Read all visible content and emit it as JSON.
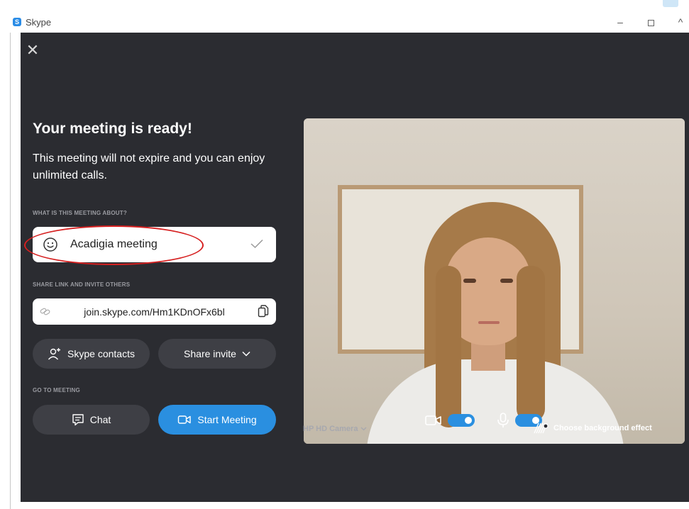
{
  "window": {
    "app_title": "Skype",
    "minimize_symbol": "–",
    "close_symbol": "^"
  },
  "panel": {
    "close_symbol": "✕",
    "heading": "Your meeting is ready!",
    "subtext": "This meeting will not expire and you can enjoy unlimited calls.",
    "about_label": "WHAT IS THIS MEETING ABOUT?",
    "meeting_name": "Acadigia meeting",
    "share_label": "SHARE LINK AND INVITE OTHERS",
    "link": "join.skype.com/Hm1KDnOFx6bl",
    "contacts_button": "Skype contacts",
    "share_invite_button": "Share invite",
    "goto_label": "GO TO MEETING",
    "chat_button": "Chat",
    "start_button": "Start Meeting"
  },
  "preview": {
    "video_enabled": true,
    "mic_enabled": true,
    "camera_name": "HP HD Camera",
    "background_effect_label": "Choose background effect"
  },
  "colors": {
    "panel_bg": "#2b2c31",
    "pill_bg": "#3e3f45",
    "accent": "#2a8fe0",
    "annotation": "#d62020"
  },
  "icons": [
    "skype-icon",
    "close-icon",
    "smiley-icon",
    "check-icon",
    "link-icon",
    "copy-icon",
    "add-contact-icon",
    "chevron-down-icon",
    "chat-icon",
    "video-camera-icon",
    "microphone-icon",
    "background-effect-icon"
  ]
}
